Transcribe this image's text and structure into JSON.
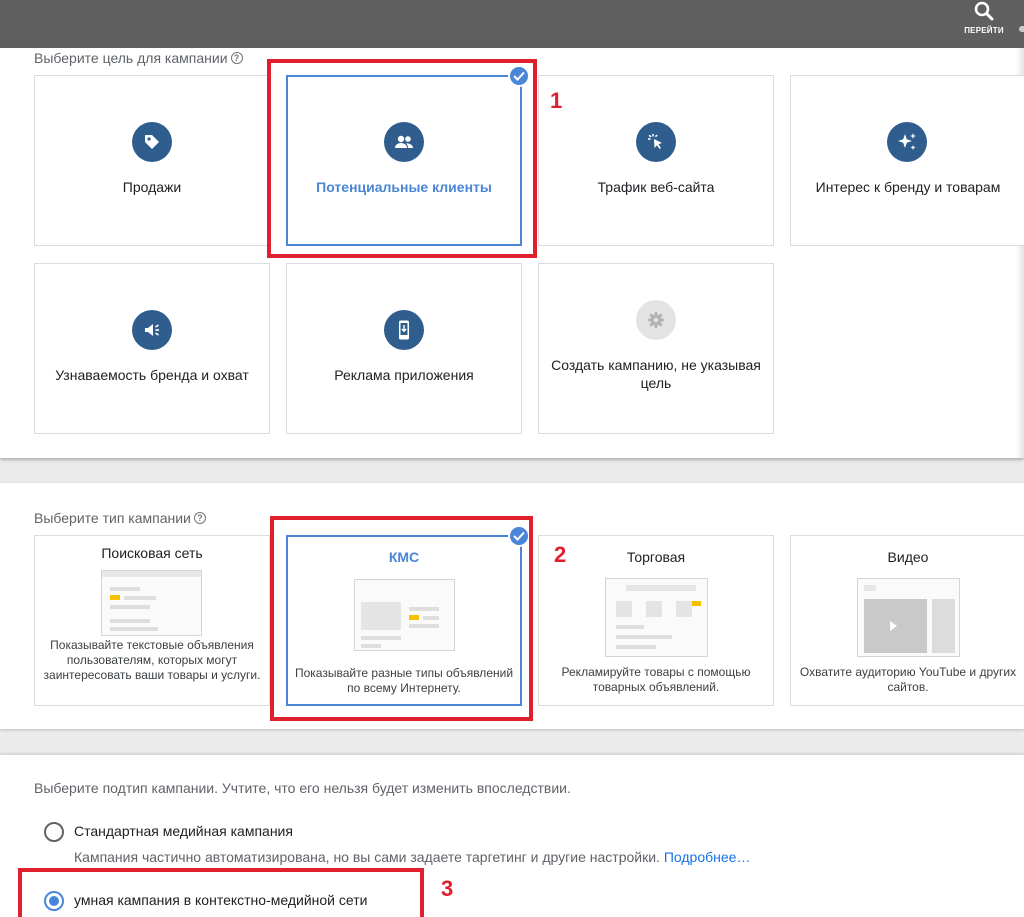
{
  "topbar": {
    "search_label": "ПЕРЕЙТИ"
  },
  "goals": {
    "title": "Выберите цель для кампании",
    "items": [
      {
        "label": "Продажи",
        "icon": "tag-icon"
      },
      {
        "label": "Потенциальные клиенты",
        "icon": "people-icon",
        "selected": true
      },
      {
        "label": "Трафик веб-сайта",
        "icon": "cursor-click-icon"
      },
      {
        "label": "Интерес к бренду и товарам",
        "icon": "sparkle-icon"
      },
      {
        "label": "Узнаваемость бренда и охват",
        "icon": "megaphone-icon"
      },
      {
        "label": "Реклама приложения",
        "icon": "mobile-app-icon"
      },
      {
        "label": "Создать кампанию, не указывая цель",
        "icon": "gear-icon",
        "disabled": true
      }
    ]
  },
  "types": {
    "title": "Выберите тип кампании",
    "items": [
      {
        "title": "Поисковая сеть",
        "desc": "Показывайте текстовые объявления пользователям, которых могут заинтересовать ваши товары и услуги."
      },
      {
        "title": "КМС",
        "desc": "Показывайте разные типы объявлений по всему Интернету.",
        "selected": true
      },
      {
        "title": "Торговая",
        "desc": "Рекламируйте товары с помощью товарных объявлений."
      },
      {
        "title": "Видео",
        "desc": "Охватите аудиторию YouTube и других сайтов."
      }
    ]
  },
  "subtype": {
    "title": "Выберите подтип кампании. Учтите, что его нельзя будет изменить впоследствии.",
    "options": [
      {
        "label": "Стандартная медийная кампания",
        "desc": "Кампания частично автоматизирована, но вы сами задаете таргетинг и другие настройки.",
        "link": "Подробнее…",
        "checked": false
      },
      {
        "label": "умная кампания в контекстно-медийной сети",
        "checked": true
      }
    ]
  },
  "annotations": [
    "1",
    "2",
    "3"
  ],
  "colors": {
    "accent": "#4a86d8",
    "icon_bg": "#2f5e8e",
    "highlight": "#e0202c",
    "topbar": "#5f5f5f"
  }
}
